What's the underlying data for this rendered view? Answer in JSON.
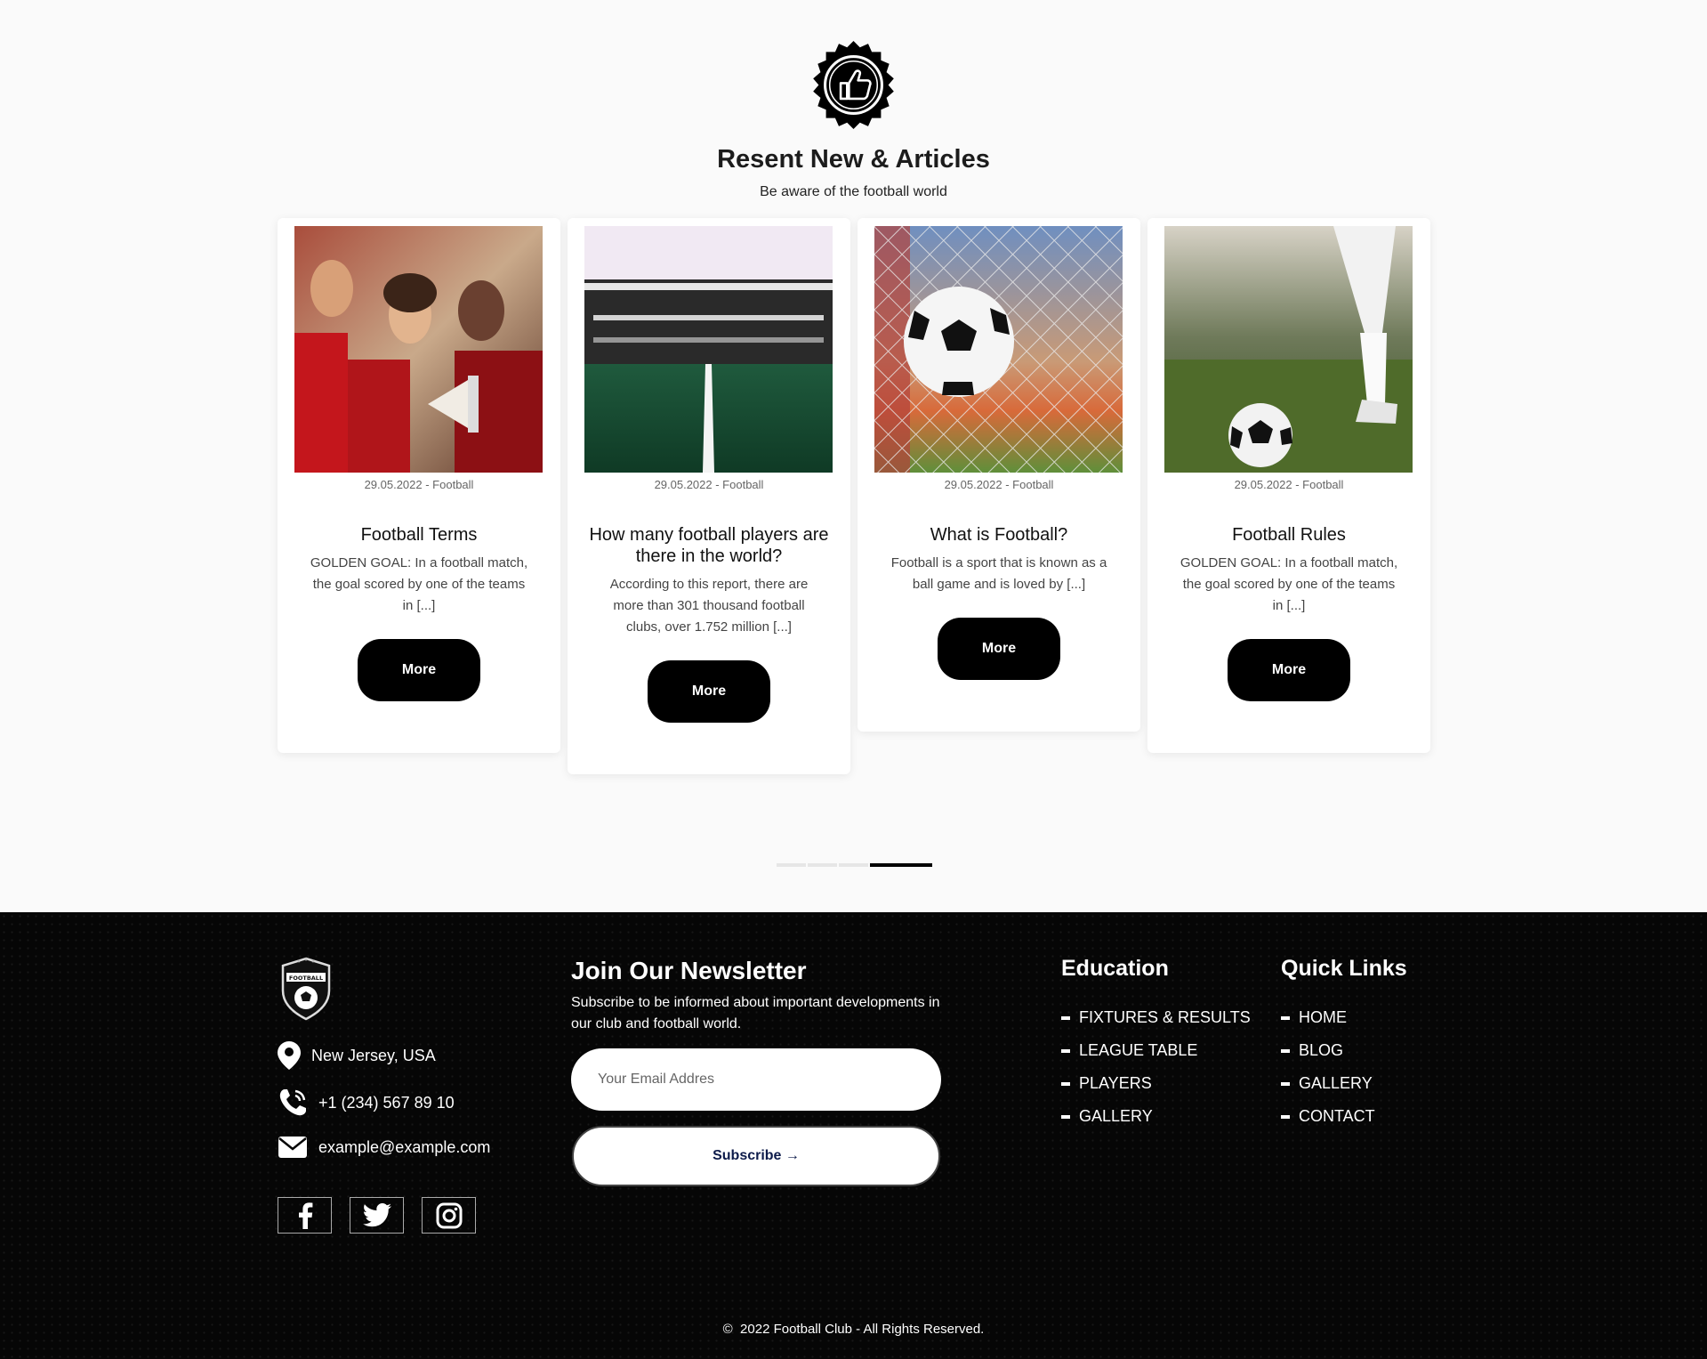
{
  "section": {
    "title": "Resent New & Articles",
    "subtitle": "Be aware of the football world"
  },
  "articles": [
    {
      "meta": "29.05.2022 - Football",
      "title": "Football Terms",
      "desc": "GOLDEN GOAL: In a football match, the goal scored by one of the teams in [...]",
      "button": "More"
    },
    {
      "meta": "29.05.2022 - Football",
      "title": "How many football players are there in the world?",
      "desc": "According to this report, there are more than 301 thousand football clubs, over 1.752 million [...]",
      "button": "More"
    },
    {
      "meta": "29.05.2022 - Football",
      "title": "What is Football?",
      "desc": "Football is a sport that is known as a ball game and is loved by [...]",
      "button": "More"
    },
    {
      "meta": "29.05.2022 - Football",
      "title": "Football Rules",
      "desc": "GOLDEN GOAL: In a football match, the goal scored by one of the teams in [...]",
      "button": "More"
    }
  ],
  "carousel": {
    "pages": 4,
    "active_page": 4
  },
  "footer": {
    "contact": {
      "address": "New Jersey, USA",
      "phone": "+1 (234) 567 89 10",
      "email": "example@example.com"
    },
    "socials": [
      "facebook-icon",
      "twitter-icon",
      "instagram-icon"
    ],
    "newsletter": {
      "title": "Join Our Newsletter",
      "text": "Subscribe to be informed about important developments in our club and football world.",
      "placeholder": "Your Email Addres",
      "button": "Subscribe →"
    },
    "education": {
      "title": "Education",
      "links": [
        "FIXTURES & RESULTS",
        "LEAGUE TABLE",
        "PLAYERS",
        "GALLERY"
      ]
    },
    "quick_links": {
      "title": "Quick Links",
      "links": [
        "HOME",
        "BLOG",
        "GALLERY",
        "CONTACT"
      ]
    },
    "copyright": "2022 Football Club - All Rights Reserved."
  },
  "colors": {
    "accent": "#000000",
    "footer_bg": "#060606",
    "page_bg": "#fafafa"
  }
}
